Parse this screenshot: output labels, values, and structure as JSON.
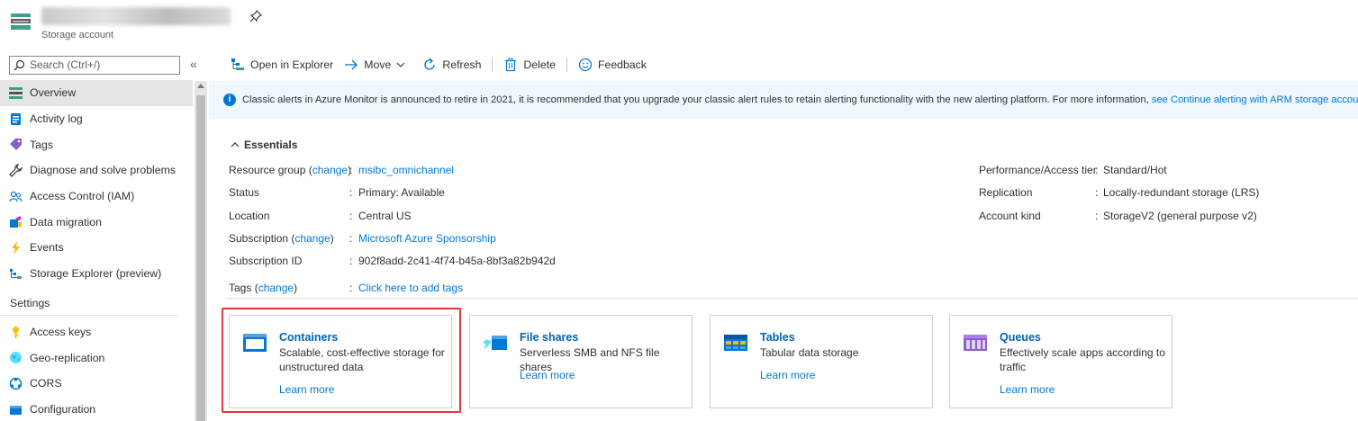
{
  "header": {
    "resource_type": "Storage account",
    "resource_name": "sbcloudmsibcstorage"
  },
  "sidebar": {
    "search_placeholder": "Search (Ctrl+/)",
    "collapse_label": "«",
    "items": [
      {
        "label": "Overview",
        "icon": "overview-icon"
      },
      {
        "label": "Activity log",
        "icon": "activity-log-icon"
      },
      {
        "label": "Tags",
        "icon": "tag-icon"
      },
      {
        "label": "Diagnose and solve problems",
        "icon": "wrench-icon"
      },
      {
        "label": "Access Control (IAM)",
        "icon": "people-icon"
      },
      {
        "label": "Data migration",
        "icon": "data-migration-icon"
      },
      {
        "label": "Events",
        "icon": "lightning-icon"
      },
      {
        "label": "Storage Explorer (preview)",
        "icon": "storage-explorer-icon"
      }
    ],
    "settings_heading": "Settings",
    "settings_items": [
      {
        "label": "Access keys",
        "icon": "key-icon"
      },
      {
        "label": "Geo-replication",
        "icon": "globe-icon"
      },
      {
        "label": "CORS",
        "icon": "cors-icon"
      },
      {
        "label": "Configuration",
        "icon": "configuration-icon"
      }
    ]
  },
  "toolbar": {
    "open_in_explorer": "Open in Explorer",
    "move": "Move",
    "refresh": "Refresh",
    "delete": "Delete",
    "feedback": "Feedback"
  },
  "info_banner": {
    "text": "Classic alerts in Azure Monitor is announced to retire in 2021, it is recommended that you upgrade your classic alert rules to retain alerting functionality with the new alerting platform. For more information,",
    "link": "see Continue alerting with ARM storage accounts."
  },
  "essentials": {
    "heading": "Essentials",
    "change_label": "change",
    "left": {
      "resource_group_label": "Resource group",
      "resource_group_value": "msibc_omnichannel",
      "status_label": "Status",
      "status_value": "Primary: Available",
      "location_label": "Location",
      "location_value": "Central US",
      "subscription_label": "Subscription",
      "subscription_value": "Microsoft Azure Sponsorship",
      "subscription_id_label": "Subscription ID",
      "subscription_id_value": "902f8add-2c41-4f74-b45a-8bf3a82b942d",
      "tags_label": "Tags",
      "tags_value": "Click here to add tags"
    },
    "right": {
      "performance_label": "Performance/Access tier",
      "performance_value": "Standard/Hot",
      "replication_label": "Replication",
      "replication_value": "Locally-redundant storage (LRS)",
      "account_kind_label": "Account kind",
      "account_kind_value": "StorageV2 (general purpose v2)"
    }
  },
  "services": [
    {
      "title": "Containers",
      "description": "Scalable, cost-effective storage for unstructured data",
      "link": "Learn more",
      "icon": "containers-icon"
    },
    {
      "title": "File shares",
      "description": "Serverless SMB and NFS file shares",
      "link": "Learn more",
      "icon": "file-shares-icon"
    },
    {
      "title": "Tables",
      "description": "Tabular data storage",
      "link": "Learn more",
      "icon": "tables-icon"
    },
    {
      "title": "Queues",
      "description": "Effectively scale apps according to traffic",
      "link": "Learn more",
      "icon": "queues-icon"
    }
  ],
  "colors": {
    "accent": "#0078d4",
    "highlight": "#e0383a",
    "info_bg": "#eff6fc"
  }
}
